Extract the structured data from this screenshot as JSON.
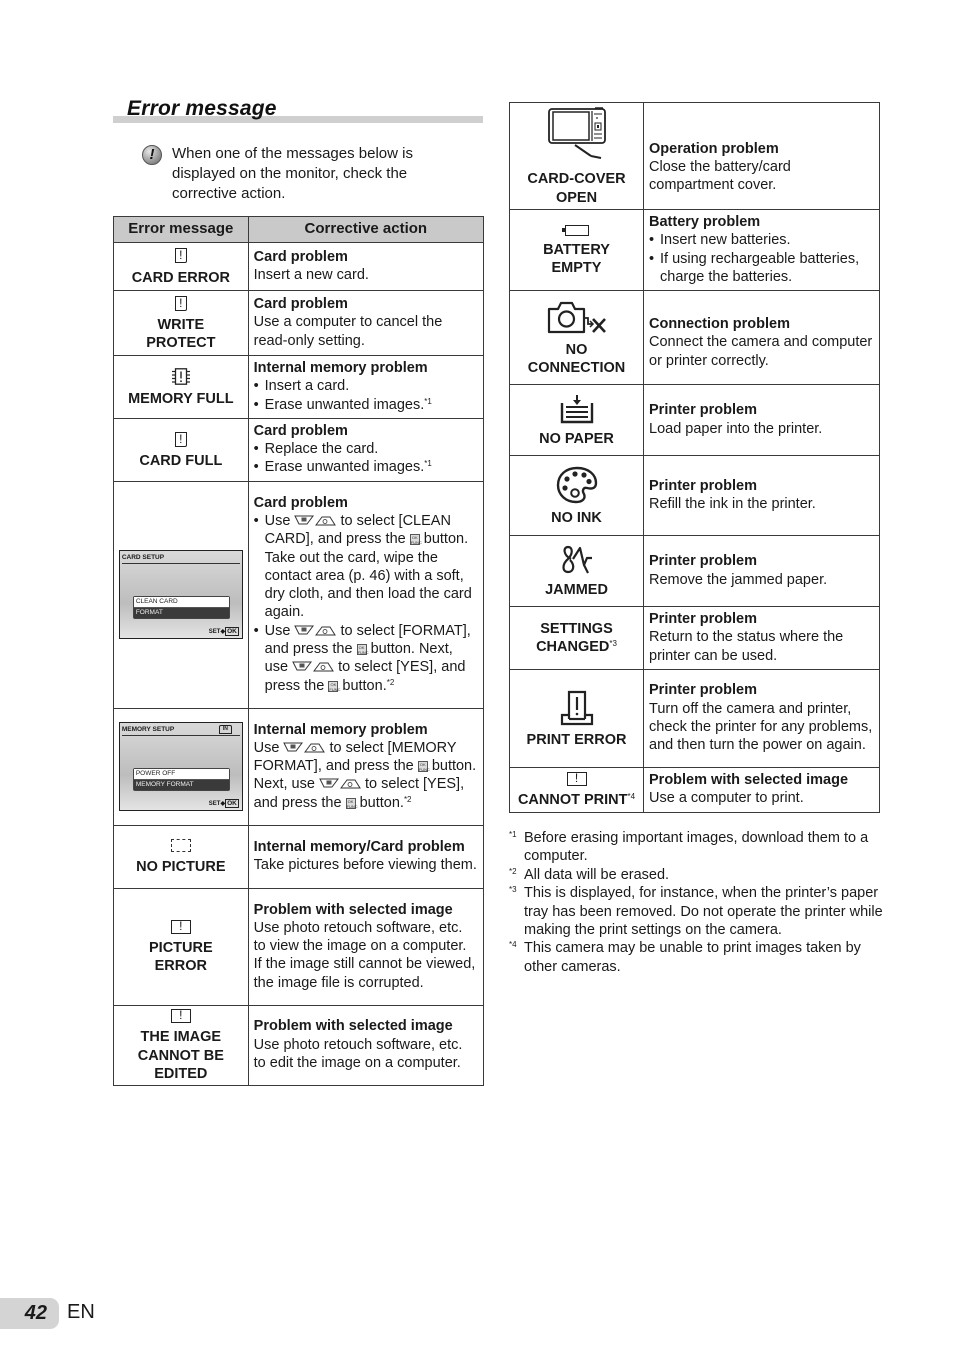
{
  "section_title": "Error message",
  "note": {
    "icon": "caution-icon",
    "text": "When one of the messages below is displayed on the monitor, check the corrective action."
  },
  "left_table": {
    "headers": [
      "Error message",
      "Corrective action"
    ],
    "rows": [
      {
        "icon": "card-error-icon",
        "message": "CARD ERROR",
        "title": "Card problem",
        "text": "Insert a new card."
      },
      {
        "icon": "card-error-icon",
        "message": "WRITE PROTECT",
        "title": "Card problem",
        "text": "Use a computer to cancel the read-only setting."
      },
      {
        "icon": "memory-error-icon",
        "message": "MEMORY FULL",
        "title": "Internal memory problem",
        "bullets": [
          "Insert a card.",
          "Erase unwanted images."
        ],
        "bullet_notes": [
          "",
          "*1"
        ]
      },
      {
        "icon": "card-error-icon",
        "message": "CARD FULL",
        "title": "Card problem",
        "bullets": [
          "Replace the card.",
          "Erase unwanted images."
        ],
        "bullet_notes": [
          "",
          "*1"
        ]
      },
      {
        "screen": {
          "title": "CARD SETUP",
          "options": [
            "CLEAN CARD",
            "FORMAT"
          ],
          "set_label": "SET",
          "ok_label": "OK"
        },
        "title": "Card problem",
        "bullets": [
          "Use [up/down] to select [CLEAN CARD], and press the [OK] button. Take out the card, wipe the contact area (p. 46) with a soft, dry cloth, and then load the card again.",
          "Use [up/down] to select [FORMAT], and press the [OK] button. Next, use [up/down] to select [YES], and press the [OK] button."
        ],
        "bullet_parts": [
          [
            "Use",
            "to select [CLEAN CARD], and press the",
            "button. Take out the card, wipe the contact area (p. 46) with a soft, dry cloth, and then load the card again."
          ],
          [
            "Use",
            "to select [FORMAT], and press the",
            "button. Next, use",
            "to select [YES], and press the",
            "button."
          ]
        ],
        "bullet_notes": [
          "",
          "*2"
        ]
      },
      {
        "screen": {
          "title": "MEMORY SETUP",
          "badge": "IN",
          "options": [
            "POWER OFF",
            "MEMORY FORMAT"
          ],
          "set_label": "SET",
          "ok_label": "OK"
        },
        "title": "Internal memory problem",
        "parts": [
          "Use",
          "to select [MEMORY FORMAT], and press the",
          "button. Next, use",
          "to select [YES], and press the",
          "button."
        ],
        "note": "*2"
      },
      {
        "icon": "no-picture-icon",
        "message": "NO PICTURE",
        "title": "Internal memory/Card problem",
        "text": "Take pictures before viewing them."
      },
      {
        "icon": "picture-error-icon",
        "message": "PICTURE ERROR",
        "title": "Problem with selected image",
        "text": "Use photo retouch software, etc. to view the image on a computer. If the image still cannot be viewed, the image file is corrupted."
      },
      {
        "icon": "picture-error-icon",
        "message": "THE IMAGE CANNOT BE EDITED",
        "title": "Problem with selected image",
        "text": "Use photo retouch software, etc. to edit the image on a computer."
      }
    ]
  },
  "right_table": {
    "rows": [
      {
        "icon": "camera-card-cover-icon",
        "message": "CARD-COVER OPEN",
        "title": "Operation problem",
        "text": "Close the battery/card compartment cover."
      },
      {
        "icon": "battery-empty-icon",
        "message": "BATTERY EMPTY",
        "title": "Battery problem",
        "bullets": [
          "Insert new batteries.",
          "If using rechargeable batteries, charge the batteries."
        ]
      },
      {
        "icon": "no-connection-icon",
        "message": "NO CONNECTION",
        "title": "Connection problem",
        "text": "Connect the camera and computer or printer correctly."
      },
      {
        "icon": "no-paper-icon",
        "message": "NO PAPER",
        "title": "Printer problem",
        "text": "Load paper into the printer."
      },
      {
        "icon": "no-ink-icon",
        "message": "NO INK",
        "title": "Printer problem",
        "text": "Refill the ink in the printer."
      },
      {
        "icon": "jammed-icon",
        "message": "JAMMED",
        "title": "Printer problem",
        "text": "Remove the jammed paper."
      },
      {
        "message": "SETTINGS CHANGED",
        "message_note": "*3",
        "title": "Printer problem",
        "text": "Return to the status where the printer can be used."
      },
      {
        "icon": "print-error-icon",
        "message": "PRINT ERROR",
        "title": "Printer problem",
        "text": "Turn off the camera and printer, check the printer for any problems, and then turn the power on again."
      },
      {
        "icon": "picture-error-icon",
        "message": "CANNOT PRINT",
        "message_note": "*4",
        "title": "Problem with selected image",
        "text": "Use a computer to print."
      }
    ]
  },
  "footnotes": [
    {
      "mark": "*1",
      "text": "Before erasing important images, download them to a computer."
    },
    {
      "mark": "*2",
      "text": "All data will be erased."
    },
    {
      "mark": "*3",
      "text": "This is displayed, for instance, when the printer’s paper tray has been removed. Do not operate the printer while making the print settings on the camera."
    },
    {
      "mark": "*4",
      "text": "This camera may be unable to print images taken by other cameras."
    }
  ],
  "page": {
    "number": "42",
    "lang": "EN"
  }
}
